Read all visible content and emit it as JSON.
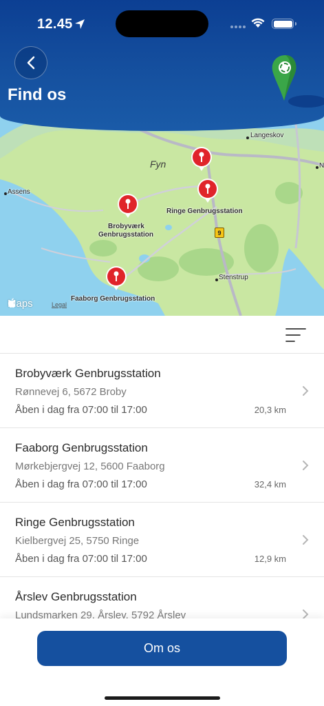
{
  "status_bar": {
    "time": "12.45"
  },
  "header": {
    "title": "Find os"
  },
  "map": {
    "region_label": "Fyn",
    "towns": [
      "Langeskov",
      "Assens",
      "Stenstrup",
      "N"
    ],
    "road_number": "9",
    "pins": [
      {
        "label": "Brobyværk\nGenbrugsstation"
      },
      {
        "label": "Ringe Genbrugsstation"
      },
      {
        "label": "Faaborg Genbrugsstation"
      },
      {
        "label": ""
      }
    ],
    "pin_label_broby_1": "Brobyværk",
    "pin_label_broby_2": "Genbrugsstation",
    "maps_brand": "Maps",
    "legal": "Legal"
  },
  "stations": [
    {
      "name": "Brobyværk Genbrugsstation",
      "address": "Rønnevej 6, 5672 Broby",
      "hours": "Åben i dag fra 07:00 til 17:00",
      "distance": "20,3 km"
    },
    {
      "name": "Faaborg Genbrugsstation",
      "address": "Mørkebjergvej 12, 5600 Faaborg",
      "hours": "Åben i dag fra 07:00 til 17:00",
      "distance": "32,4 km"
    },
    {
      "name": "Ringe Genbrugsstation",
      "address": "Kielbergvej 25, 5750 Ringe",
      "hours": "Åben i dag fra 07:00 til 17:00",
      "distance": "12,9 km"
    },
    {
      "name": "Årslev Genbrugsstation",
      "address": "Lundsmarken 29, Årslev, 5792 Årslev",
      "hours": "",
      "distance": ""
    }
  ],
  "bottom": {
    "button_label": "Om os"
  },
  "colors": {
    "brand_blue": "#15509f",
    "header_dark": "#0c3f93",
    "pin_red": "#e0242a",
    "logo_green": "#3aa648"
  },
  "icons": {
    "back": "chevron-left-icon",
    "filter": "sort-lines-icon",
    "row": "chevron-right-icon",
    "location": "location-arrow-icon"
  }
}
